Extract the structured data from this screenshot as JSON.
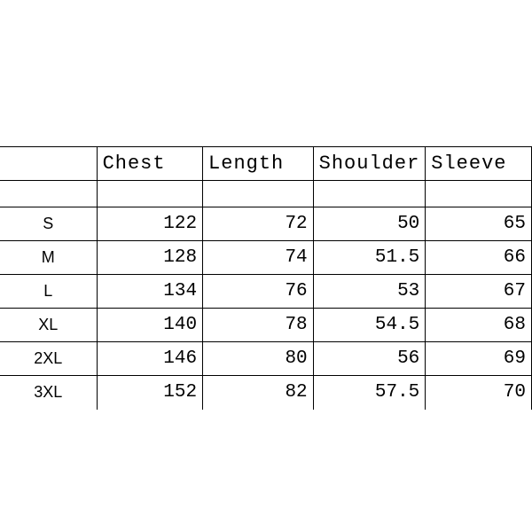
{
  "chart_data": {
    "type": "table",
    "headers": [
      "",
      "Chest",
      "Length",
      "Shoulder",
      "Sleeve"
    ],
    "rows": [
      {
        "size": "S",
        "chest": 122,
        "length": 72,
        "shoulder": 50,
        "sleeve": 65
      },
      {
        "size": "M",
        "chest": 128,
        "length": 74,
        "shoulder": 51.5,
        "sleeve": 66
      },
      {
        "size": "L",
        "chest": 134,
        "length": 76,
        "shoulder": 53,
        "sleeve": 67
      },
      {
        "size": "XL",
        "chest": 140,
        "length": 78,
        "shoulder": 54.5,
        "sleeve": 68
      },
      {
        "size": "2XL",
        "chest": 146,
        "length": 80,
        "shoulder": 56,
        "sleeve": 69
      },
      {
        "size": "3XL",
        "chest": 152,
        "length": 82,
        "shoulder": 57.5,
        "sleeve": 70
      }
    ]
  }
}
